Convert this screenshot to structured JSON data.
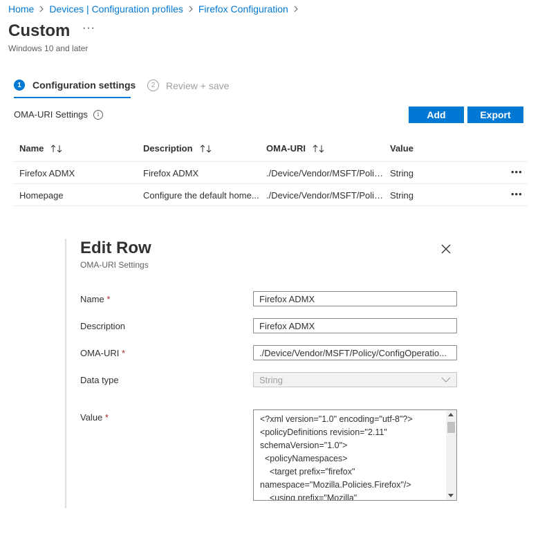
{
  "breadcrumb": [
    {
      "label": "Home"
    },
    {
      "label": "Devices | Configuration profiles"
    },
    {
      "label": "Firefox Configuration"
    }
  ],
  "page": {
    "title": "Custom",
    "more": "···",
    "subtitle": "Windows 10 and later"
  },
  "steps": [
    {
      "number": "1",
      "label": "Configuration settings",
      "active": true
    },
    {
      "number": "2",
      "label": "Review + save",
      "active": false
    }
  ],
  "section": {
    "label": "OMA-URI Settings",
    "info_icon": "i",
    "add_label": "Add",
    "export_label": "Export"
  },
  "table": {
    "headers": [
      "Name",
      "Description",
      "OMA-URI",
      "Value"
    ],
    "rows": [
      {
        "name": "Firefox ADMX",
        "description": "Firefox ADMX",
        "oma_uri": "./Device/Vendor/MSFT/Polic...",
        "value": "String",
        "more": "•••"
      },
      {
        "name": "Homepage",
        "description": "Configure the default home...",
        "oma_uri": "./Device/Vendor/MSFT/Polic...",
        "value": "String",
        "more": "•••"
      }
    ]
  },
  "edit_panel": {
    "title": "Edit Row",
    "subtitle": "OMA-URI Settings",
    "required_mark": "*",
    "fields": {
      "name_label": "Name",
      "name_value": "Firefox ADMX",
      "description_label": "Description",
      "description_value": "Firefox ADMX",
      "oma_uri_label": "OMA-URI",
      "oma_uri_value": "./Device/Vendor/MSFT/Policy/ConfigOperatio...",
      "data_type_label": "Data type",
      "data_type_value": "String",
      "value_label": "Value",
      "value_text": "<?xml version=\"1.0\" encoding=\"utf-8\"?>\n<policyDefinitions revision=\"2.11\"\nschemaVersion=\"1.0\">\n  <policyNamespaces>\n    <target prefix=\"firefox\"\nnamespace=\"Mozilla.Policies.Firefox\"/>\n    <using prefix=\"Mozilla\""
    }
  },
  "colors": {
    "accent": "#0078d4",
    "required": "#a4262c"
  }
}
